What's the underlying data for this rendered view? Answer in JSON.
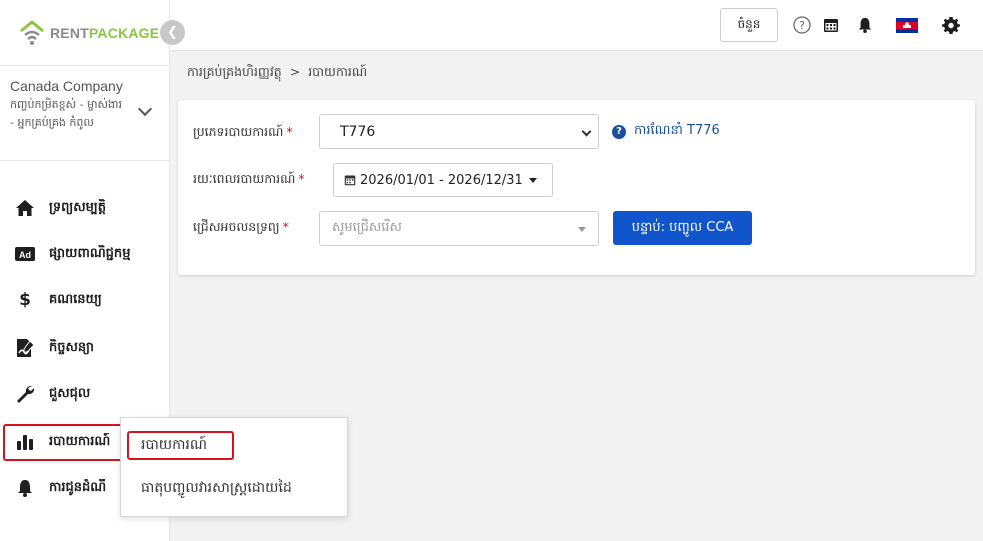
{
  "brand": {
    "name_part1": "RENT",
    "name_part2": "PACKAGE",
    "gray": "#8a8a8a",
    "green": "#8cc63f"
  },
  "colors": {
    "accent_blue": "#1155cc",
    "highlight_red": "#d6121f",
    "link_blue": "#1a4f9c"
  },
  "company": {
    "name": "Canada Company",
    "subtitle": "កញ្ចប់កម្រិតខ្ពស់ - ម្ចាស់ងារ - អ្នកគ្រប់គ្រង កំពូល"
  },
  "sidebar": {
    "items": [
      {
        "label": "ទ្រព្យសម្បត្តិ",
        "icon": "home-icon"
      },
      {
        "label": "ផ្សាយពាណិជ្ជកម្ម",
        "icon": "ad-icon"
      },
      {
        "label": "គណនេយ្យ",
        "icon": "dollar-icon"
      },
      {
        "label": "កិច្ចសន្យា",
        "icon": "signature-icon"
      },
      {
        "label": "ជួសជុល",
        "icon": "wrench-icon"
      },
      {
        "label": "របាយការណ៍",
        "icon": "bar-chart-icon"
      },
      {
        "label": "ការជូនដំណឹ",
        "icon": "bell-icon"
      }
    ]
  },
  "header": {
    "currency_label": "ចំនួន",
    "icons": [
      "help-icon",
      "calendar-icon",
      "bell-icon",
      "cambodia-flag-icon",
      "gear-icon"
    ]
  },
  "breadcrumb": {
    "parent": "ការគ្រប់គ្រងហិរញ្ញវត្ថុ",
    "separator": ">",
    "current": "របាយការណ៍"
  },
  "form": {
    "report_type": {
      "label": "ប្រភេទរបាយការណ៍",
      "value": "T776"
    },
    "help": {
      "label": "ការណែនាំ T776"
    },
    "period": {
      "label": "រយៈពេលរបាយការណ៍",
      "value": "2026/01/01 - 2026/12/31"
    },
    "property": {
      "label": "ជ្រើសអចលនទ្រព្យ",
      "placeholder": "សូមជ្រើសរើស"
    },
    "submit_label": "បន្ទាប់: បញ្ចូល CCA"
  },
  "popover": {
    "items": [
      {
        "label": "របាយការណ៍"
      },
      {
        "label": "ធាតុបញ្ចូលវារសាស្រ្តដោយដៃ"
      }
    ]
  }
}
